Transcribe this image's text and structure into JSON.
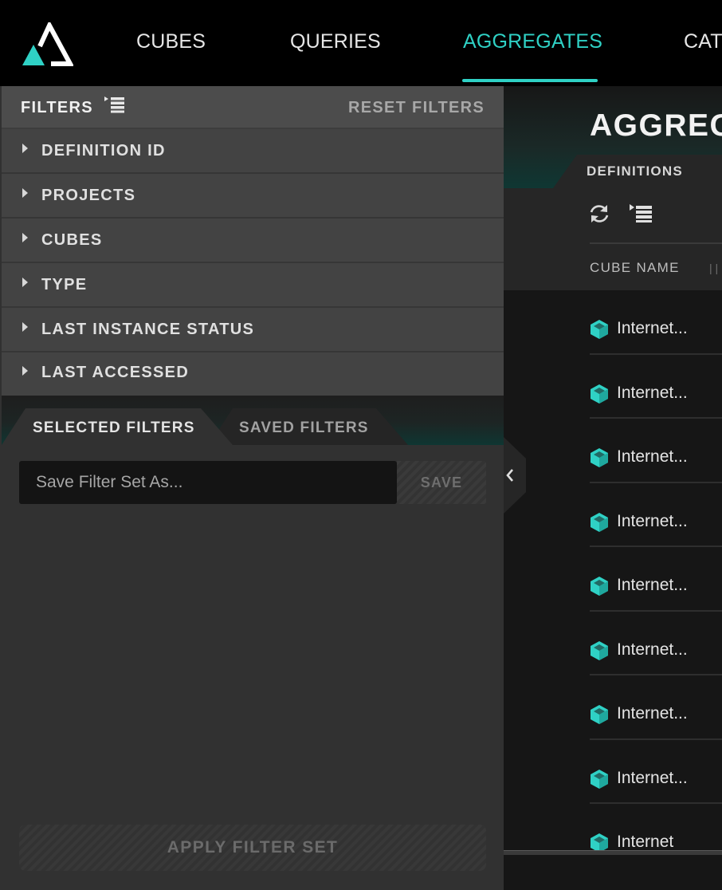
{
  "nav": {
    "items": [
      {
        "label": "CUBES",
        "active": false
      },
      {
        "label": "QUERIES",
        "active": false
      },
      {
        "label": "AGGREGATES",
        "active": true
      },
      {
        "label": "CAT",
        "active": false
      }
    ]
  },
  "main": {
    "title": "AGGREG",
    "tab_label": "DEFINITIONS",
    "column_header": "CUBE NAME",
    "column_separator": "| |",
    "rows": [
      {
        "label": "Internet..."
      },
      {
        "label": "Internet..."
      },
      {
        "label": "Internet..."
      },
      {
        "label": "Internet..."
      },
      {
        "label": "Internet..."
      },
      {
        "label": "Internet..."
      },
      {
        "label": "Internet..."
      },
      {
        "label": "Internet..."
      },
      {
        "label": "Internet"
      }
    ]
  },
  "filters": {
    "title": "FILTERS",
    "reset_label": "RESET FILTERS",
    "facets": [
      {
        "label": "DEFINITION ID"
      },
      {
        "label": "PROJECTS"
      },
      {
        "label": "CUBES"
      },
      {
        "label": "TYPE"
      },
      {
        "label": "LAST INSTANCE STATUS"
      },
      {
        "label": "LAST ACCESSED"
      }
    ],
    "tabs": {
      "selected_label": "SELECTED FILTERS",
      "saved_label": "SAVED FILTERS",
      "active": "SELECTED FILTERS"
    },
    "save_placeholder": "Save Filter Set As...",
    "save_label": "SAVE",
    "apply_label": "APPLY FILTER SET"
  },
  "colors": {
    "accent": "#2fd1c5",
    "nav_background": "#000000",
    "panel_background": "#313131"
  },
  "icons": {
    "logo": "triangle-logo",
    "list_filter": "list-filter-icon",
    "refresh": "refresh-icon",
    "cube": "cube-icon",
    "caret": "caret-right-icon",
    "collapse": "chevron-left-icon"
  }
}
